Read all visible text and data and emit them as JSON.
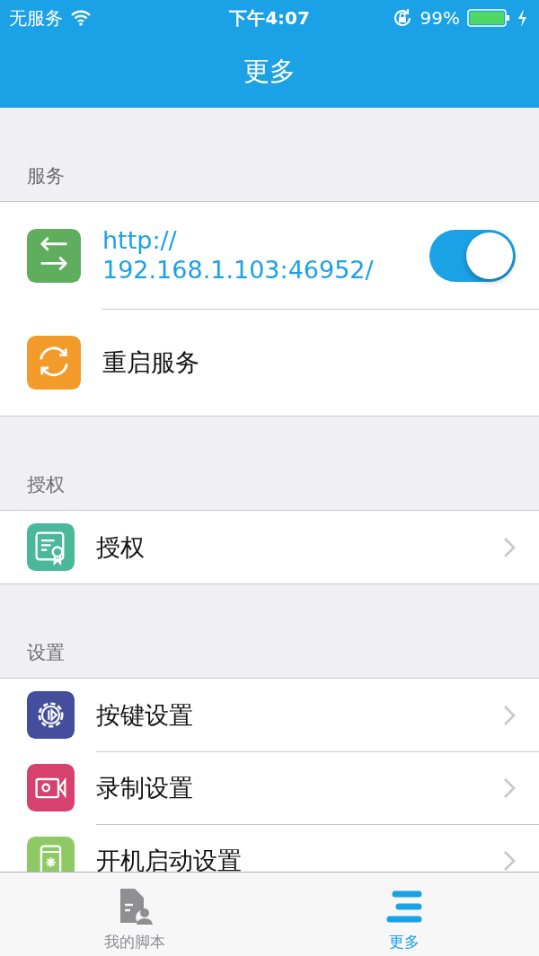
{
  "status_bar": {
    "carrier": "无服务",
    "time": "下午4:07",
    "battery": "99%"
  },
  "nav": {
    "title": "更多"
  },
  "sections": [
    {
      "header": "服务",
      "rows": [
        {
          "kind": "toggle",
          "label": "http://\n192.168.1.103:46952/",
          "color": "#5fae5d",
          "on": true
        },
        {
          "kind": "action",
          "label": "重启服务",
          "color": "#f29b2b"
        }
      ]
    },
    {
      "header": "授权",
      "rows": [
        {
          "kind": "link",
          "label": "授权",
          "color": "#4bb89c"
        }
      ]
    },
    {
      "header": "设置",
      "rows": [
        {
          "kind": "link",
          "label": "按键设置",
          "color": "#434f9c"
        },
        {
          "kind": "link",
          "label": "录制设置",
          "color": "#d6416d"
        },
        {
          "kind": "link",
          "label": "开机启动设置",
          "color": "#8fc965"
        }
      ]
    }
  ],
  "tabs": [
    {
      "label": "我的脚本",
      "selected": false
    },
    {
      "label": "更多",
      "selected": true
    }
  ]
}
